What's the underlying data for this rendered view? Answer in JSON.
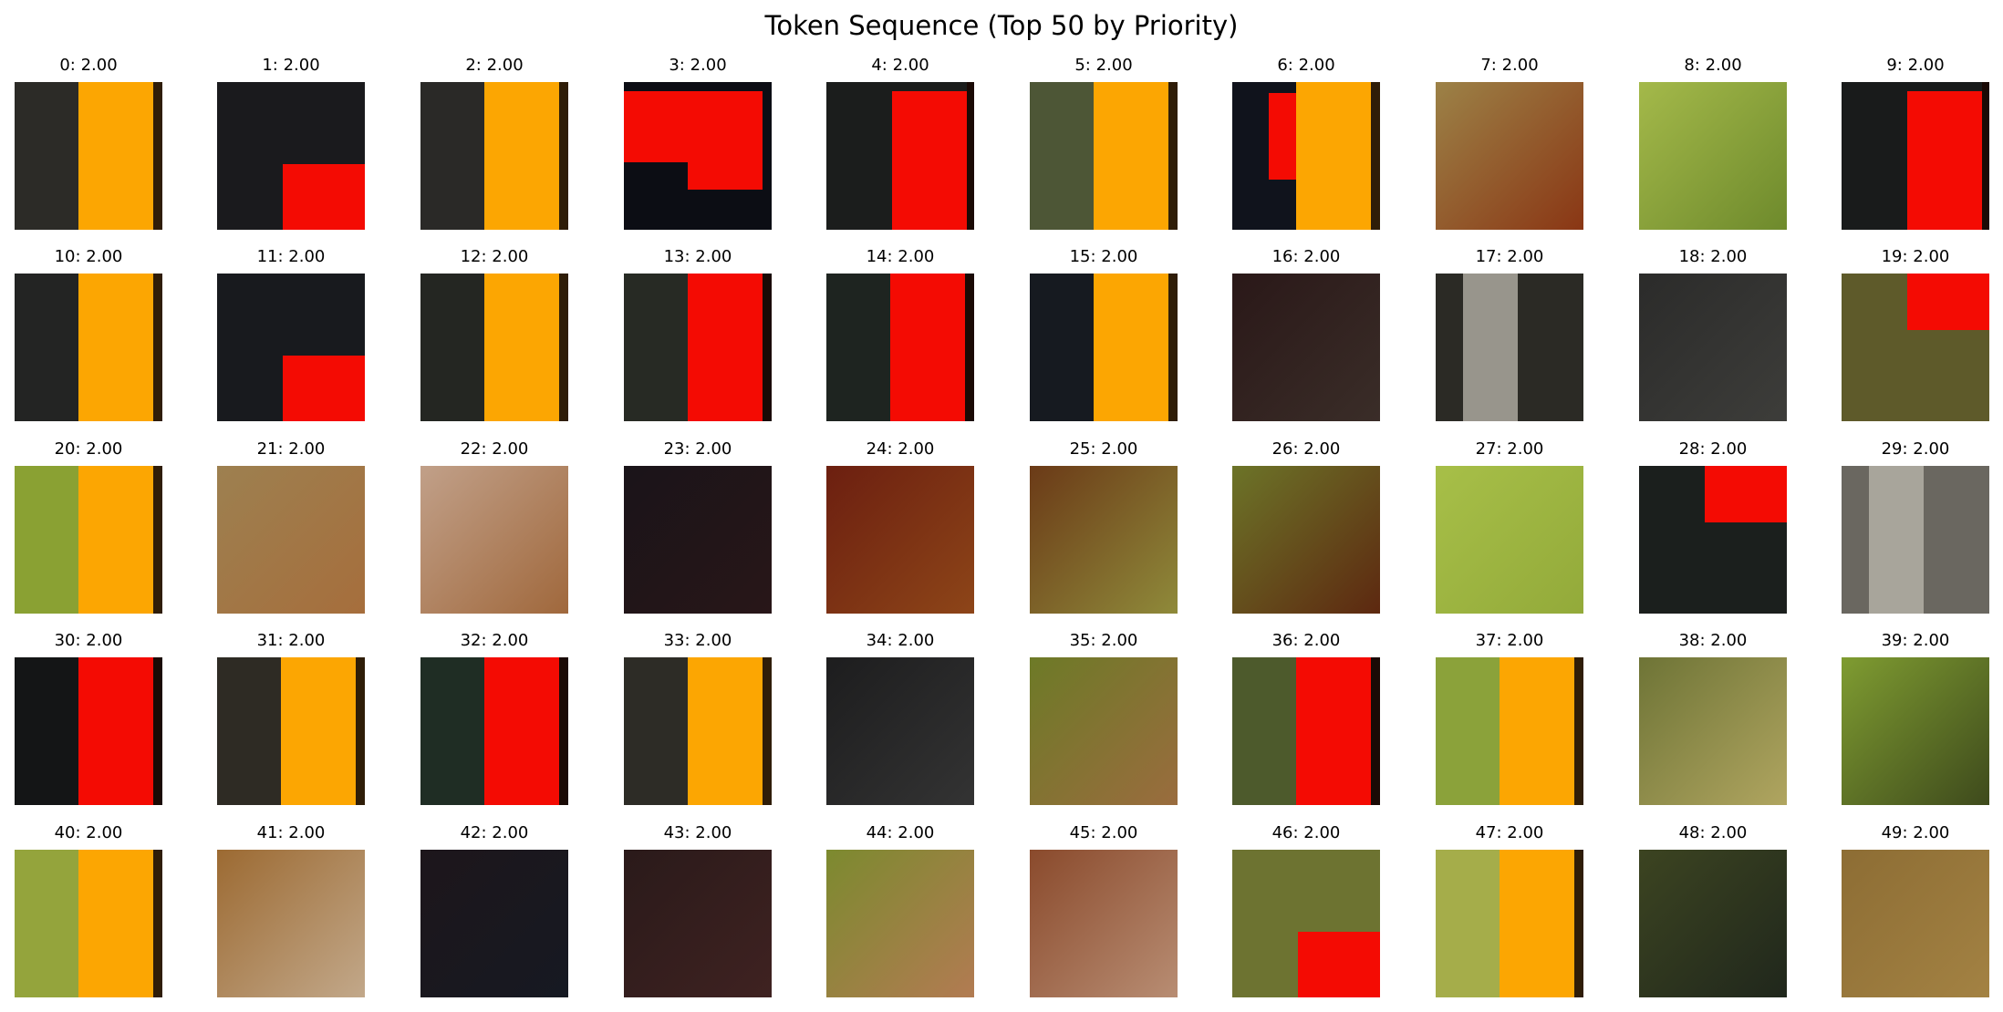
{
  "title": "Token Sequence (Top 50 by Priority)",
  "columns": 10,
  "tiles": [
    {
      "label": "0: 2.00",
      "style": "stripe-orange",
      "bg": "#2c2b27"
    },
    {
      "label": "1: 2.00",
      "style": "block-red-br",
      "bg": "#1a1a1d"
    },
    {
      "label": "2: 2.00",
      "style": "stripe-orange",
      "bg": "#2a2927"
    },
    {
      "label": "3: 2.00",
      "style": "block-red-top",
      "bg": "#0c0d14"
    },
    {
      "label": "4: 2.00",
      "style": "stripe-red-right",
      "bg": "#1b1d1c"
    },
    {
      "label": "5: 2.00",
      "style": "stripe-orange",
      "bg": "#4d5636"
    },
    {
      "label": "6: 2.00",
      "style": "stripe-orange-red",
      "bg": "#10131c"
    },
    {
      "label": "7: 2.00",
      "style": "blur",
      "bg": "#9c8247",
      "bg2": "#8a3614"
    },
    {
      "label": "8: 2.00",
      "style": "blur",
      "bg": "#a4b94a",
      "bg2": "#6e8a2c"
    },
    {
      "label": "9: 2.00",
      "style": "stripe-red-right",
      "bg": "#191b1b"
    },
    {
      "label": "10: 2.00",
      "style": "stripe-orange",
      "bg": "#232423"
    },
    {
      "label": "11: 2.00",
      "style": "block-red-br",
      "bg": "#181a1e"
    },
    {
      "label": "12: 2.00",
      "style": "stripe-orange",
      "bg": "#242622"
    },
    {
      "label": "13: 2.00",
      "style": "stripe-red",
      "bg": "#272a24"
    },
    {
      "label": "14: 2.00",
      "style": "stripe-red",
      "bg": "#1e2420"
    },
    {
      "label": "15: 2.00",
      "style": "stripe-orange",
      "bg": "#161a20"
    },
    {
      "label": "16: 2.00",
      "style": "blur",
      "bg": "#2a1818",
      "bg2": "#3a2d28"
    },
    {
      "label": "17: 2.00",
      "style": "light-stripe",
      "bg": "#2b2a25"
    },
    {
      "label": "18: 2.00",
      "style": "blur",
      "bg": "#2b2b2a",
      "bg2": "#3d3d3a"
    },
    {
      "label": "19: 2.00",
      "style": "block-red-tr",
      "bg": "#5e5a2a"
    },
    {
      "label": "20: 2.00",
      "style": "stripe-orange",
      "bg": "#8aa133"
    },
    {
      "label": "21: 2.00",
      "style": "blur",
      "bg": "#9d8050",
      "bg2": "#a66e3c"
    },
    {
      "label": "22: 2.00",
      "style": "blur",
      "bg": "#c1a089",
      "bg2": "#a0683c"
    },
    {
      "label": "23: 2.00",
      "style": "blur",
      "bg": "#1a1419",
      "bg2": "#281618"
    },
    {
      "label": "24: 2.00",
      "style": "blur",
      "bg": "#6c1f10",
      "bg2": "#8d4518"
    },
    {
      "label": "25: 2.00",
      "style": "blur",
      "bg": "#6b3a17",
      "bg2": "#8f8a3a"
    },
    {
      "label": "26: 2.00",
      "style": "blur",
      "bg": "#6c7428",
      "bg2": "#5d2810"
    },
    {
      "label": "27: 2.00",
      "style": "blur",
      "bg": "#a7bf48",
      "bg2": "#93aa3a"
    },
    {
      "label": "28: 2.00",
      "style": "block-red-tr",
      "bg": "#1b1f1d"
    },
    {
      "label": "29: 2.00",
      "style": "light-stripe",
      "bg": "#6a6760"
    },
    {
      "label": "30: 2.00",
      "style": "stripe-red",
      "bg": "#141516"
    },
    {
      "label": "31: 2.00",
      "style": "stripe-orange",
      "bg": "#2e2b24"
    },
    {
      "label": "32: 2.00",
      "style": "stripe-red",
      "bg": "#1f2d24"
    },
    {
      "label": "33: 2.00",
      "style": "stripe-orange",
      "bg": "#2d2c26"
    },
    {
      "label": "34: 2.00",
      "style": "blur",
      "bg": "#1d1d1e",
      "bg2": "#333333"
    },
    {
      "label": "35: 2.00",
      "style": "blur",
      "bg": "#6d7a27",
      "bg2": "#9a6c3e"
    },
    {
      "label": "36: 2.00",
      "style": "stripe-red",
      "bg": "#4d5a2c"
    },
    {
      "label": "37: 2.00",
      "style": "stripe-orange",
      "bg": "#8ba23a"
    },
    {
      "label": "38: 2.00",
      "style": "blur",
      "bg": "#6e7436",
      "bg2": "#b0a560"
    },
    {
      "label": "39: 2.00",
      "style": "blur",
      "bg": "#7f9c31",
      "bg2": "#3e4a1c"
    },
    {
      "label": "40: 2.00",
      "style": "stripe-orange",
      "bg": "#94a43c"
    },
    {
      "label": "41: 2.00",
      "style": "blur",
      "bg": "#9c6a32",
      "bg2": "#c2a88a"
    },
    {
      "label": "42: 2.00",
      "style": "blur",
      "bg": "#1d161b",
      "bg2": "#161922"
    },
    {
      "label": "43: 2.00",
      "style": "blur",
      "bg": "#2a1a1a",
      "bg2": "#3f2221"
    },
    {
      "label": "44: 2.00",
      "style": "blur",
      "bg": "#7c8a2f",
      "bg2": "#b27b52"
    },
    {
      "label": "45: 2.00",
      "style": "blur",
      "bg": "#8a4a2c",
      "bg2": "#b88d73"
    },
    {
      "label": "46: 2.00",
      "style": "block-red-br",
      "bg": "#6d7331"
    },
    {
      "label": "47: 2.00",
      "style": "stripe-orange",
      "bg": "#a5ad4a"
    },
    {
      "label": "48: 2.00",
      "style": "blur",
      "bg": "#3c4421",
      "bg2": "#20271c"
    },
    {
      "label": "49: 2.00",
      "style": "blur",
      "bg": "#8d6d34",
      "bg2": "#a38243"
    }
  ],
  "colors": {
    "orange": "#fca602",
    "red": "#f40b03",
    "edge": "#2f1d08"
  }
}
